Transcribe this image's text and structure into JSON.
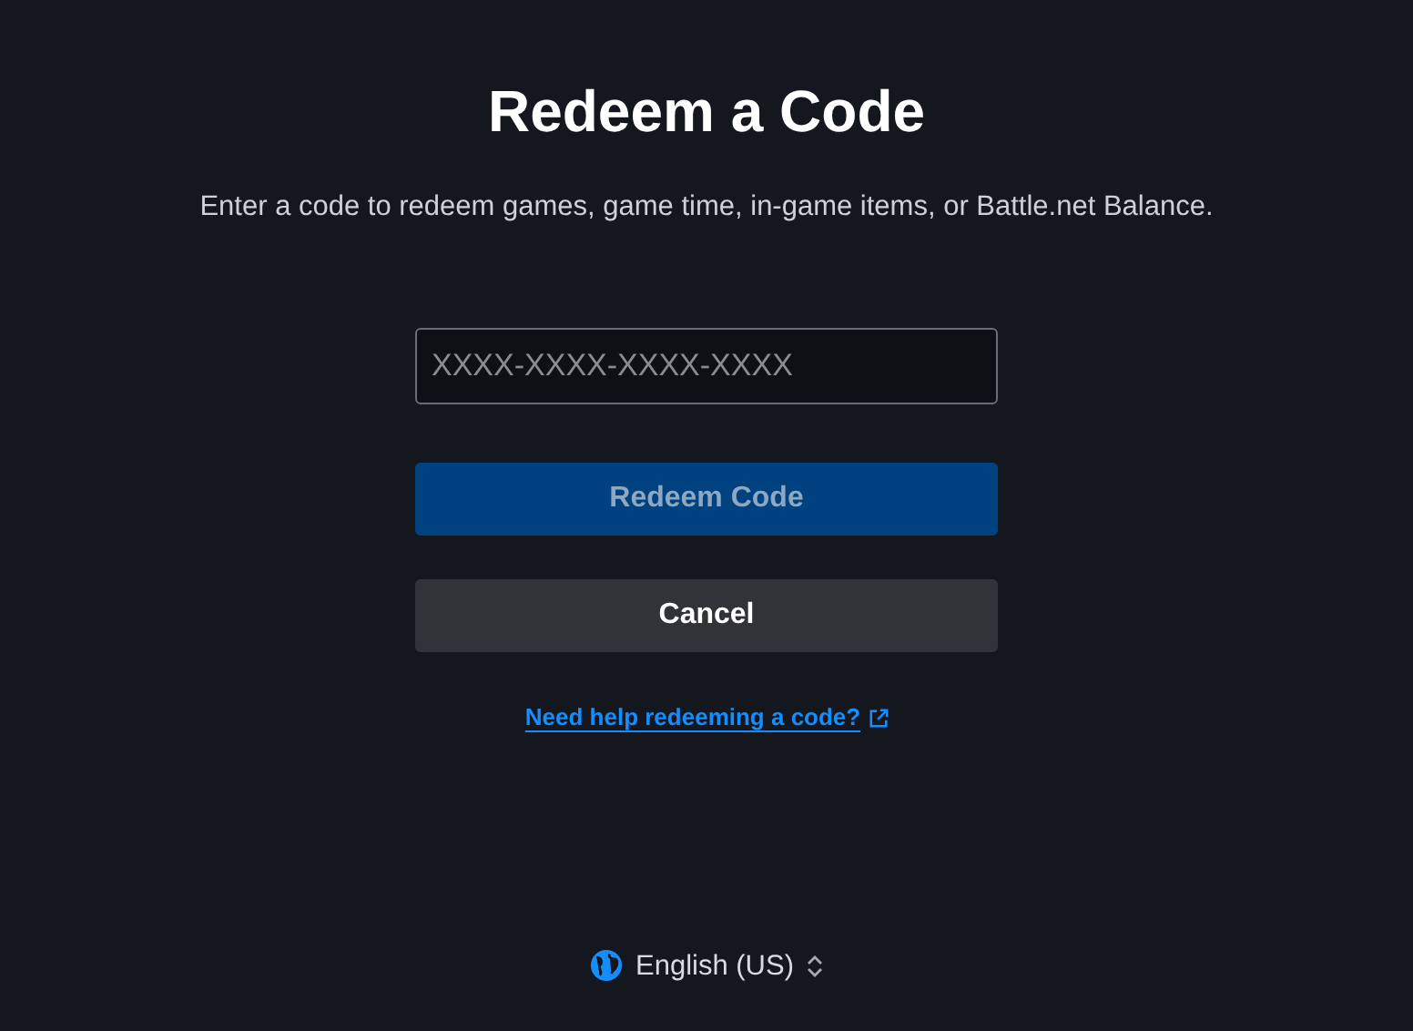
{
  "title": "Redeem a Code",
  "subtitle": "Enter a code to redeem games, game time, in-game items, or Battle.net Balance.",
  "code_field": {
    "placeholder": "XXXX-XXXX-XXXX-XXXX"
  },
  "buttons": [
    {
      "label": "Redeem Code",
      "kind": "primary",
      "disabled": true
    },
    {
      "label": "Cancel",
      "kind": "secondary",
      "disabled": false
    }
  ],
  "help_link": "Need help redeeming a code?",
  "language": "English (US)"
}
